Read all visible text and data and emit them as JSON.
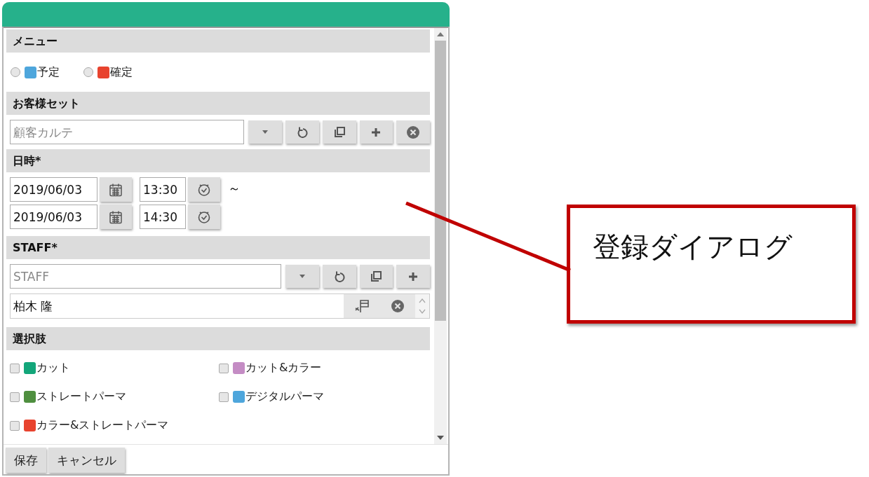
{
  "menu": {
    "title": "メニュー",
    "options": [
      {
        "label": "予定",
        "color": "#4ea6dc",
        "selected": false
      },
      {
        "label": "確定",
        "color": "#e8432e",
        "selected": false
      }
    ]
  },
  "customer": {
    "title": "お客様セット",
    "placeholder": "顧客カルテ"
  },
  "datetime": {
    "title": "日時*",
    "separator": "～",
    "rows": [
      {
        "date": "2019/06/03",
        "time": "13:30"
      },
      {
        "date": "2019/06/03",
        "time": "14:30"
      }
    ]
  },
  "staff": {
    "title": "STAFF*",
    "placeholder": "STAFF",
    "members": [
      "柏木 隆"
    ]
  },
  "choices": {
    "title": "選択肢",
    "items": [
      {
        "label": "カット",
        "color": "#13a67a",
        "checked": false
      },
      {
        "label": "カット&カラー",
        "color": "#c48cc4",
        "checked": false
      },
      {
        "label": "ストレートパーマ",
        "color": "#4f8f3f",
        "checked": false
      },
      {
        "label": "デジタルパーマ",
        "color": "#4ea6dc",
        "checked": false
      },
      {
        "label": "カラー&ストレートパーマ",
        "color": "#e8432e",
        "checked": false
      }
    ]
  },
  "buttons": [
    "保存",
    "キャンセル"
  ],
  "callout": {
    "text": "登録ダイアログ"
  }
}
